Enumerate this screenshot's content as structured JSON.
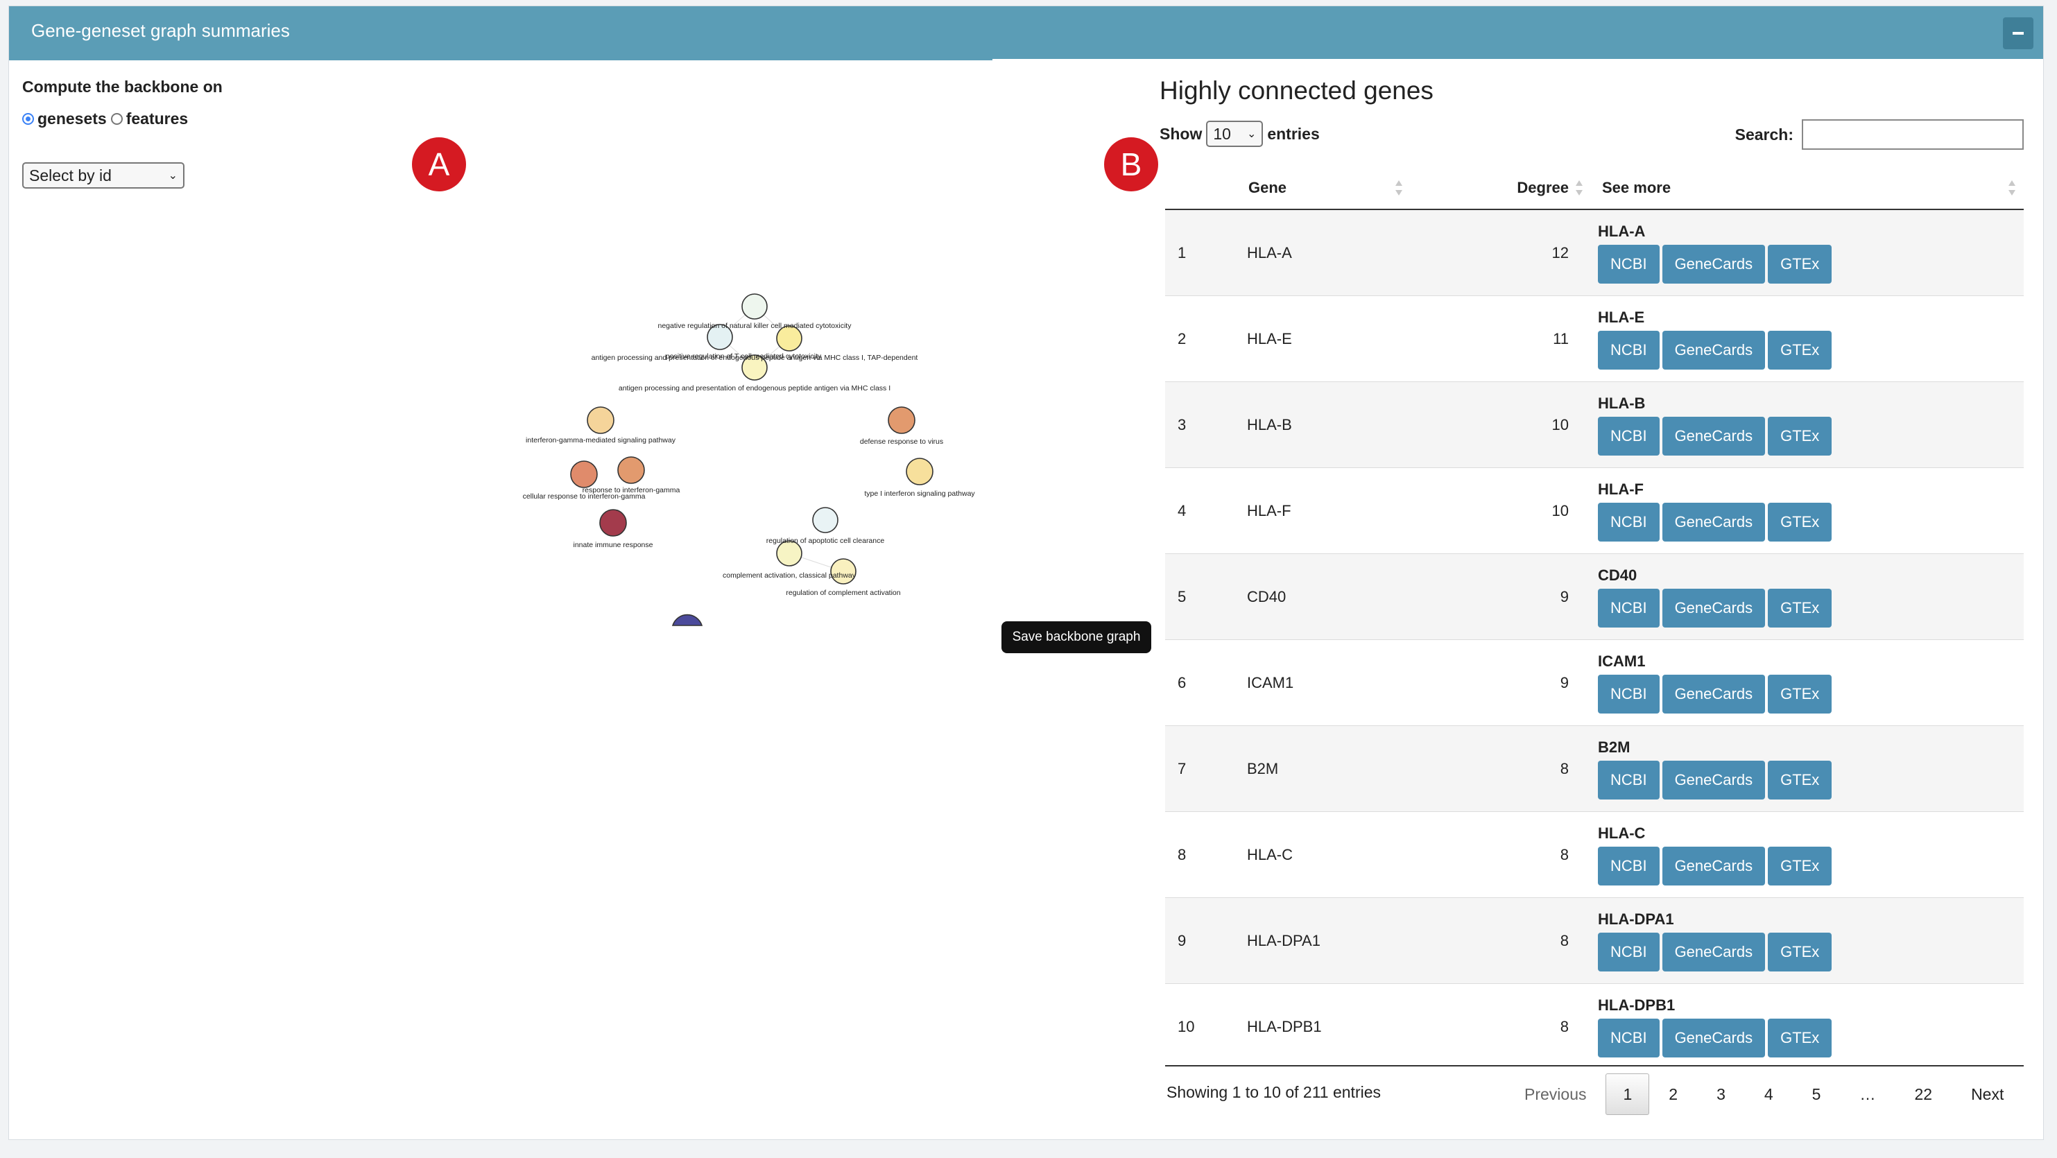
{
  "panel": {
    "title": "Gene-geneset graph summaries"
  },
  "left": {
    "compute_label": "Compute the backbone on",
    "radio_genesets": "genesets",
    "radio_features": "features",
    "select_label": "Select by id",
    "badge_a": "A",
    "save_button": "Save backbone graph",
    "graph_labels": [
      "negative regulation of natural killer cell mediated cytotoxicity",
      "positive regulation of T cell mediated cytotoxicity",
      "antigen processing and presentation of endogenous peptide antigen via MHC class I, TAP-dependent",
      "antigen processing and presentation of endogenous peptide antigen via MHC class I",
      "interferon-gamma-mediated signaling pathway",
      "defense response to virus",
      "response to interferon-gamma",
      "cellular response to interferon-gamma",
      "type I interferon signaling pathway",
      "innate immune response",
      "regulation of apoptotic cell clearance",
      "complement activation, classical pathway",
      "regulation of complement activation"
    ],
    "node_colors": {
      "very_light": "#eef6f6",
      "light_yellow": "#fbf2b8",
      "yellow": "#f7dfa0",
      "orange": "#e9a775",
      "coral": "#dc8a6a",
      "dark_red": "#a33b4c",
      "purple": "#4b4a9b"
    }
  },
  "right": {
    "title": "Highly connected genes",
    "badge_b": "B",
    "show_label": "Show",
    "entries_value": "10",
    "entries_label": "entries",
    "search_label": "Search:",
    "search_value": "",
    "columns": {
      "gene": "Gene",
      "degree": "Degree",
      "see_more": "See more"
    },
    "buttons": {
      "ncbi": "NCBI",
      "genecards": "GeneCards",
      "gtex": "GTEx"
    },
    "rows": [
      {
        "idx": "1",
        "gene": "HLA-A",
        "degree": "12"
      },
      {
        "idx": "2",
        "gene": "HLA-E",
        "degree": "11"
      },
      {
        "idx": "3",
        "gene": "HLA-B",
        "degree": "10"
      },
      {
        "idx": "4",
        "gene": "HLA-F",
        "degree": "10"
      },
      {
        "idx": "5",
        "gene": "CD40",
        "degree": "9"
      },
      {
        "idx": "6",
        "gene": "ICAM1",
        "degree": "9"
      },
      {
        "idx": "7",
        "gene": "B2M",
        "degree": "8"
      },
      {
        "idx": "8",
        "gene": "HLA-C",
        "degree": "8"
      },
      {
        "idx": "9",
        "gene": "HLA-DPA1",
        "degree": "8"
      },
      {
        "idx": "10",
        "gene": "HLA-DPB1",
        "degree": "8"
      }
    ],
    "info": "Showing 1 to 10 of 211 entries",
    "pager": {
      "previous": "Previous",
      "pages": [
        "1",
        "2",
        "3",
        "4",
        "5",
        "…",
        "22"
      ],
      "next": "Next",
      "active": "1"
    }
  }
}
